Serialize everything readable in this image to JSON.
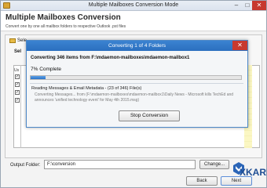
{
  "window": {
    "title": "Multiple Mailboxes Conversion Mode"
  },
  "header": {
    "title": "Multiple Mailboxes Conversion",
    "subtitle": "Convert one by one all mailbox folders to respective Outlook .pst files"
  },
  "form": {
    "select_label": "Sele",
    "section_label": "Sel",
    "list_header": "Us",
    "checkbox_marks": [
      "✓",
      "✓",
      "✓",
      "✓"
    ],
    "output_label": "Output Folder:",
    "output_value": "F:\\conversion",
    "change_label": "Change...",
    "back_label": "Back",
    "next_label": "Next",
    "logo_text": "XKARE"
  },
  "dialog": {
    "title": "Converting 1 of 4 Folders",
    "converting": "Converting 346 items from F:\\mdaemon-mailboxes\\mdaemon-mailbox1",
    "percent_label": "7% Complete",
    "progress": 0.07,
    "reading": "Reading Messages & Email Metadata - (23 of 346) File(s)",
    "detail": "Converting Messages... from (F:\\mdaemon-mailboxes\\mdaemon-mailbox1\\Daily News - Microsoft kills TechEd and announces 'unified technology event' for May 4th 2015.msg)",
    "stop_label": "Stop Conversion"
  },
  "colors": {
    "dialog_title_bg": "#2b6fbf",
    "close_red": "#c7392f",
    "progress_fill": "#2a73c9",
    "logo_blue": "#1f4e94"
  },
  "icons": [
    "app-icon",
    "folder-icon",
    "close-icon",
    "minimize-icon",
    "maximize-icon",
    "logo-icon"
  ]
}
